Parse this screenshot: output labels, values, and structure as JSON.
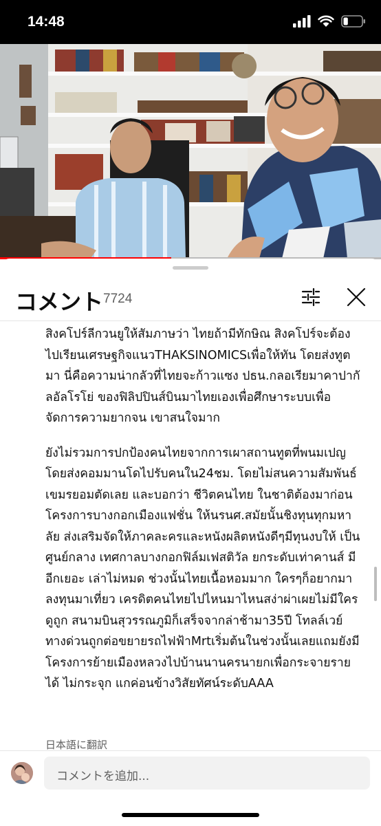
{
  "status_bar": {
    "time": "14:48",
    "battery_level": 0.25
  },
  "video": {
    "progress": 0.45
  },
  "comments": {
    "title": "コメント",
    "count": "7724",
    "paragraphs": [
      "สิงคโปร์ลีกวนยูให้สัมภาษว่า ไทยถ้ามีทักษิณ สิงคโปร์จะต้องไปเรียนเศรษฐกิจแนวTHAKSINOMICSเพื่อให้ทัน โดยส่งทูตมา นี่คือความน่ากลัวที่ไทยจะก้าวแซง ปธน.กลอเรียมาคาปากัลอัลโรโย่ ของฟิลิปปินส์บินมาไทยเองเพื่อศึกษาระบบเพื่อจัดการความยากจน เขาสนใจมาก",
      "ยังไม่รวมการปกป้องคนไทยจากการเผาสถานทูตที่พนมเปญ โดยส่งคอมมานโดไปรับคนใน24ชม. โดยไม่สนความสัมพันธ์เขมรยอมตัดเลย และบอกว่า ชีวิตคนไทย ในชาติต้องมาก่อน โครงการบางกอกเมืองแฟชั่น ให้นรนศ.สมัยนั้นชิงทุนทุกมหาลัย ส่งเสริมจัดให้ภาคละครและหนังผลิตหนังดีๆมีทุนงบให้ เป็นศูนย์กลาง เทศกาลบางกอกฟิล์มเฟสติวัล ยกระดับเท่าคานส์ มีอีกเยอะ เล่าไม่หมด ช่วงนั้นไทยเนื้อหอมมาก ใครๆก็อยากมาลงทุนมาเที่ยว เครดิตคนไทยไปไหนมาไหนสง่าผ่าเผยไม่มีใครดูถูก สนามบินสุวรรณภูมิก็เสร็จจากล่าช้ามา35ปี โทลล์เวย์ทางด่วนถูกต่อขยายรถไฟฟ้าMrtเริ่มต้นในช่วงนั้นเลยแถมยังมีโครงการย้ายเมืองหลวงไปบ้านนานครนายกเพื่อกระจายรายได้ ไม่กระจุก แกค่อนข้างวิสัยทัศน์ระดับAAA"
    ],
    "translate_label": "日本語に翻訳",
    "add_comment_placeholder": "コメントを追加..."
  }
}
